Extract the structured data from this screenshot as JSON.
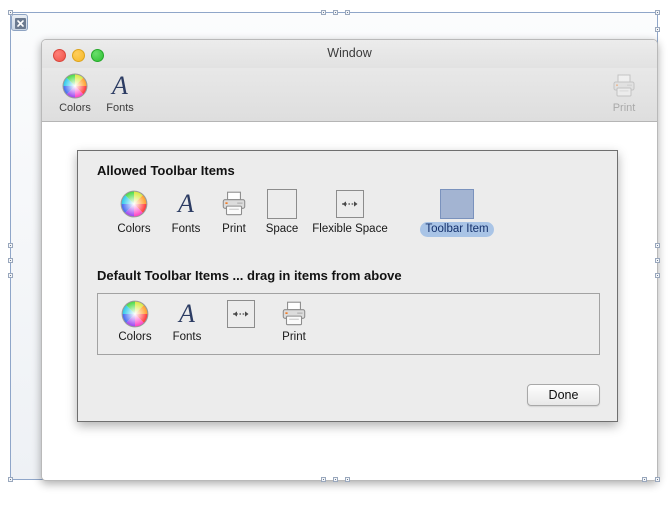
{
  "outer": {
    "close_icon": "close-icon"
  },
  "window": {
    "title": "Window",
    "traffic_lights": [
      {
        "name": "close",
        "color": "#ef5349"
      },
      {
        "name": "minimize",
        "color": "#f6b829"
      },
      {
        "name": "zoom",
        "color": "#2fc033"
      }
    ],
    "toolbar": [
      {
        "label": "Colors",
        "icon": "color-wheel-icon",
        "enabled": true
      },
      {
        "label": "Fonts",
        "icon": "font-a-icon",
        "enabled": true
      },
      {
        "label": "Print",
        "icon": "printer-icon",
        "enabled": false
      }
    ]
  },
  "sheet": {
    "allowed_heading": "Allowed Toolbar Items",
    "allowed_items": [
      {
        "label": "Colors",
        "icon": "color-wheel-icon",
        "selected": false
      },
      {
        "label": "Fonts",
        "icon": "font-a-icon",
        "selected": false
      },
      {
        "label": "Print",
        "icon": "printer-icon",
        "selected": false
      },
      {
        "label": "Space",
        "icon": "empty-square-icon",
        "selected": false
      },
      {
        "label": "Flexible Space",
        "icon": "flexible-space-icon",
        "selected": false
      },
      {
        "label": "Toolbar Item",
        "icon": "blue-square-icon",
        "selected": true
      }
    ],
    "default_heading": "Default Toolbar Items ... drag in items from above",
    "default_items": [
      {
        "label": "Colors",
        "icon": "color-wheel-icon"
      },
      {
        "label": "Fonts",
        "icon": "font-a-icon"
      },
      {
        "label": "",
        "icon": "flexible-space-icon"
      },
      {
        "label": "Print",
        "icon": "printer-icon"
      }
    ],
    "done_label": "Done"
  },
  "colors": {
    "selection_blue": "#a9c4e6",
    "selection_text": "#14306b",
    "toolbar_item_fill": "#a3b4d2",
    "sheet_bg": "#ececec"
  }
}
